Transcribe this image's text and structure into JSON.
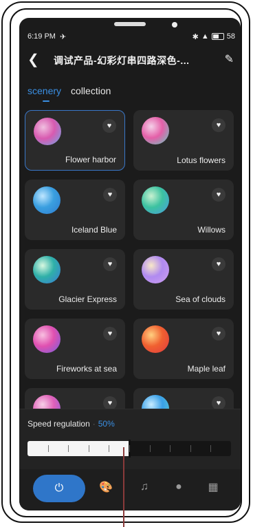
{
  "status_bar": {
    "time": "6:19 PM",
    "battery": "58"
  },
  "header": {
    "back_icon": "back-arrow-icon",
    "title": "调试产品-幻彩灯串四路深色-...",
    "edit_icon": "pencil-icon"
  },
  "tabs": [
    {
      "label": "scenery",
      "active": true
    },
    {
      "label": "collection",
      "active": false
    }
  ],
  "scenes": [
    {
      "name": "Flower harbor",
      "selected": true,
      "colors": [
        "#d85ab0",
        "#f0c0e0",
        "#6aa7e8"
      ]
    },
    {
      "name": "Lotus flowers",
      "selected": false,
      "colors": [
        "#e45fa8",
        "#f4d0e8",
        "#5fd0c0"
      ]
    },
    {
      "name": "Iceland Blue",
      "selected": false,
      "colors": [
        "#3a9fe0",
        "#bfe6ff",
        "#2e7bd0"
      ]
    },
    {
      "name": "Willows",
      "selected": false,
      "colors": [
        "#3cc2a0",
        "#c8f0d0",
        "#4a9be0"
      ]
    },
    {
      "name": "Glacier Express",
      "selected": false,
      "colors": [
        "#2fb0a8",
        "#d8f8e0",
        "#3a7ad8"
      ]
    },
    {
      "name": "Sea of clouds",
      "selected": false,
      "colors": [
        "#b08af0",
        "#f8e8c8",
        "#d0a0f0"
      ]
    },
    {
      "name": "Fireworks at sea",
      "selected": false,
      "colors": [
        "#e050b0",
        "#f8c0e0",
        "#7060e0"
      ]
    },
    {
      "name": "Maple leaf",
      "selected": false,
      "colors": [
        "#f06030",
        "#ffd080",
        "#e03a40"
      ]
    },
    {
      "name": "",
      "selected": false,
      "colors": [
        "#e060b8",
        "#f8d0e8",
        "#8060e0"
      ]
    },
    {
      "name": "",
      "selected": false,
      "colors": [
        "#3aa0e8",
        "#c8ecff",
        "#60d0d0"
      ]
    }
  ],
  "speed": {
    "label": "Speed regulation",
    "separator": "·",
    "percent_text": "50%",
    "value": 0.5,
    "ticks": 10
  },
  "bottom_nav": [
    {
      "icon": "power-icon",
      "active": true
    },
    {
      "icon": "palette-icon",
      "active": true
    },
    {
      "icon": "music-icon",
      "active": false
    },
    {
      "icon": "bulb-icon",
      "active": false
    },
    {
      "icon": "grid-icon",
      "active": false
    }
  ],
  "colors": {
    "accent": "#3a8fe3",
    "background": "#1b1b1b",
    "card": "#2a2a2a"
  }
}
